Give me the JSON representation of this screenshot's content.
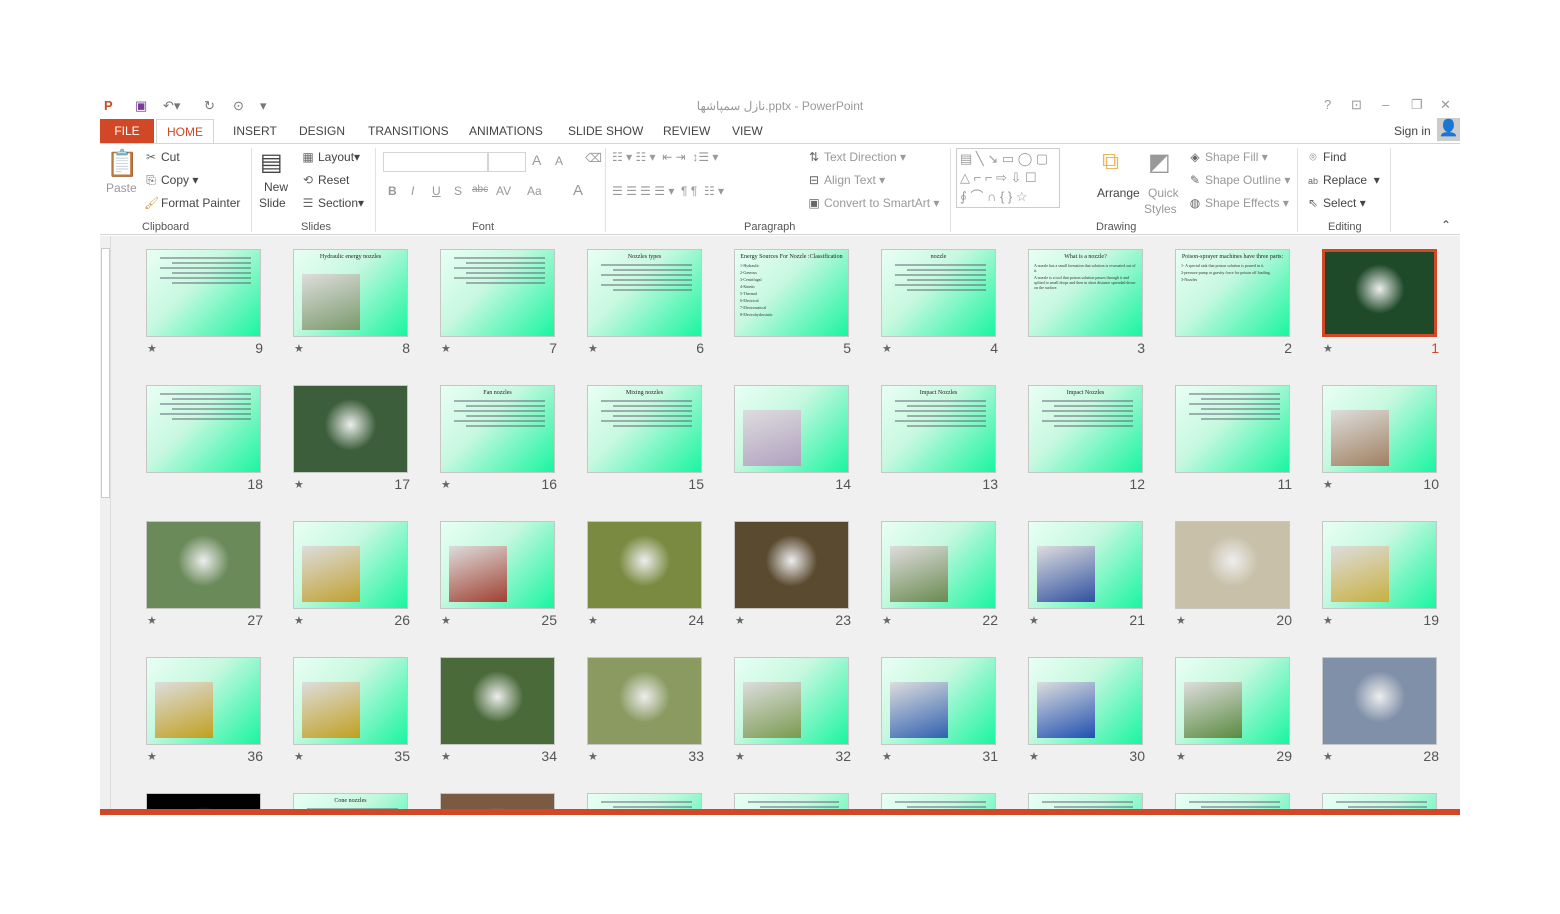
{
  "app": {
    "title": "نازل سمپاشها.pptx - PowerPoint",
    "sign_in": "Sign in",
    "accent": "#D24726"
  },
  "qat": {
    "save": "save-icon",
    "undo": "undo-icon",
    "redo": "redo-icon",
    "present": "present-icon"
  },
  "window_buttons": {
    "help": "?",
    "restore_ribbon": "⊡",
    "minimize": "–",
    "maximize": "❐",
    "close": "✕"
  },
  "tabs": [
    "FILE",
    "HOME",
    "INSERT",
    "DESIGN",
    "TRANSITIONS",
    "ANIMATIONS",
    "SLIDE SHOW",
    "REVIEW",
    "VIEW"
  ],
  "ribbon": {
    "clipboard": {
      "label": "Clipboard",
      "paste": "Paste",
      "cut": "Cut",
      "copy": "Copy",
      "format_painter": "Format Painter"
    },
    "slides": {
      "label": "Slides",
      "new_slide": "New",
      "new_slide2": "Slide",
      "layout": "Layout",
      "reset": "Reset",
      "section": "Section"
    },
    "font": {
      "label": "Font",
      "font_name": "",
      "font_size": "",
      "bold": "B",
      "italic": "I",
      "underline": "U",
      "shadow": "S",
      "strike": "abc",
      "spacing": "AV",
      "case": "Aa",
      "color": "A",
      "grow": "A",
      "shrink": "A"
    },
    "paragraph": {
      "label": "Paragraph",
      "text_direction": "Text Direction",
      "align_text": "Align Text",
      "convert_smartart": "Convert to SmartArt"
    },
    "drawing": {
      "label": "Drawing",
      "arrange": "Arrange",
      "quick_styles": "Quick",
      "quick_styles2": "Styles",
      "shape_fill": "Shape Fill",
      "shape_outline": "Shape Outline",
      "shape_effects": "Shape Effects"
    },
    "editing": {
      "label": "Editing",
      "find": "Find",
      "replace": "Replace",
      "select": "Select"
    }
  },
  "slides": [
    {
      "n": 1,
      "star": true,
      "kind": "photo",
      "bg": "#1f4a2a",
      "selected": true
    },
    {
      "n": 2,
      "star": false,
      "kind": "text",
      "title": "Poison-sprayer  machines have three parts:",
      "body": [
        "1- A special sink that poison solution is poured in it.",
        "2-pressure pump or gravity force for poison off loading.",
        "3-Nozzles"
      ]
    },
    {
      "n": 3,
      "star": false,
      "kind": "text",
      "title": "What is a nozzle?",
      "body": [
        "A nozzle has a small formation that solution is evacuated  out of it.",
        "A nozzle is a tool that poison solution passes through it and splited to small drops and then in short distance spreaded down on the surface."
      ]
    },
    {
      "n": 4,
      "star": true,
      "kind": "text",
      "title": "nozzle"
    },
    {
      "n": 5,
      "star": false,
      "kind": "text",
      "title": "Energy Sources For Nozzle :Classification",
      "body": [
        "1-Hydraulic",
        "2-Gaseous",
        "3-Centrifugal",
        "4-Kinetic",
        "5-Thermal",
        "6-Electrical",
        "7-Electrostatical",
        "8-Electrohydrostatic"
      ]
    },
    {
      "n": 6,
      "star": true,
      "kind": "text",
      "title": "Nozzles types"
    },
    {
      "n": 7,
      "star": true,
      "kind": "text",
      "title": ""
    },
    {
      "n": 8,
      "star": true,
      "kind": "mixed",
      "title": "Hydraulic energy nozzles",
      "bg": "#7a9a6a"
    },
    {
      "n": 9,
      "star": true,
      "kind": "text",
      "title": ""
    },
    {
      "n": 10,
      "star": true,
      "kind": "mixed",
      "bg": "#a08060"
    },
    {
      "n": 11,
      "star": false,
      "kind": "text",
      "title": ""
    },
    {
      "n": 12,
      "star": false,
      "kind": "text",
      "title": "Impact Nozzles"
    },
    {
      "n": 13,
      "star": false,
      "kind": "text",
      "title": "Impact Nozzles"
    },
    {
      "n": 14,
      "star": false,
      "kind": "mixed",
      "bg": "#b0a0c0"
    },
    {
      "n": 15,
      "star": false,
      "kind": "text",
      "title": "Mixing nozzles"
    },
    {
      "n": 16,
      "star": true,
      "kind": "text",
      "title": "Fan nozzles"
    },
    {
      "n": 17,
      "star": true,
      "kind": "photo",
      "bg": "#3c5e3a"
    },
    {
      "n": 18,
      "star": false,
      "kind": "text",
      "title": ""
    },
    {
      "n": 19,
      "star": true,
      "kind": "mixed",
      "bg": "#c8b040"
    },
    {
      "n": 20,
      "star": true,
      "kind": "photo",
      "bg": "#c8c0a8"
    },
    {
      "n": 21,
      "star": true,
      "kind": "mixed",
      "bg": "#3050a0"
    },
    {
      "n": 22,
      "star": true,
      "kind": "mixed",
      "bg": "#6a8a50"
    },
    {
      "n": 23,
      "star": true,
      "kind": "photo",
      "bg": "#5a4a30"
    },
    {
      "n": 24,
      "star": true,
      "kind": "photo",
      "bg": "#7a8a40"
    },
    {
      "n": 25,
      "star": true,
      "kind": "mixed",
      "bg": "#a04030"
    },
    {
      "n": 26,
      "star": true,
      "kind": "mixed",
      "bg": "#c0a030"
    },
    {
      "n": 27,
      "star": true,
      "kind": "photo",
      "bg": "#6a8a5a"
    },
    {
      "n": 28,
      "star": true,
      "kind": "photo",
      "bg": "#8090a8"
    },
    {
      "n": 29,
      "star": true,
      "kind": "mixed",
      "bg": "#5a8a40"
    },
    {
      "n": 30,
      "star": true,
      "kind": "mixed",
      "bg": "#2050b0"
    },
    {
      "n": 31,
      "star": true,
      "kind": "mixed",
      "bg": "#3060b0"
    },
    {
      "n": 32,
      "star": true,
      "kind": "mixed",
      "bg": "#7a9a50"
    },
    {
      "n": 33,
      "star": true,
      "kind": "photo",
      "bg": "#8a9a60"
    },
    {
      "n": 34,
      "star": true,
      "kind": "photo",
      "bg": "#4a6a3a"
    },
    {
      "n": 35,
      "star": true,
      "kind": "mixed",
      "bg": "#c0a020"
    },
    {
      "n": 36,
      "star": true,
      "kind": "mixed",
      "bg": "#c0a020"
    }
  ],
  "partial_row": [
    {
      "kind": "photo",
      "bg": "#000000"
    },
    {
      "kind": "text",
      "title": "Cone nozzles"
    },
    {
      "kind": "photo",
      "bg": "#7a5a40"
    },
    {
      "kind": "text"
    },
    {
      "kind": "text"
    },
    {
      "kind": "text"
    },
    {
      "kind": "text"
    },
    {
      "kind": "text"
    },
    {
      "kind": "text"
    }
  ]
}
